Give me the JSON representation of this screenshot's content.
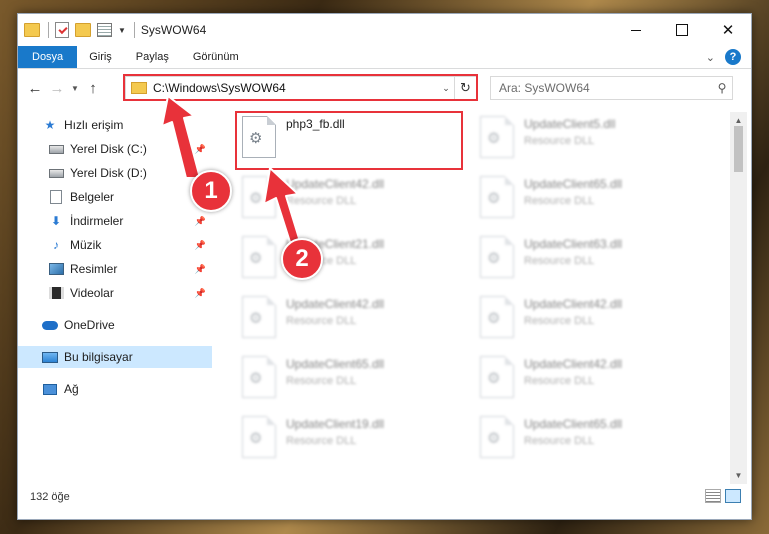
{
  "window": {
    "title": "SysWOW64",
    "controls": {
      "minimize": "",
      "maximize": "",
      "close": "✕"
    }
  },
  "ribbon": {
    "tabs": [
      "Dosya",
      "Giriş",
      "Paylaş",
      "Görünüm"
    ],
    "help": "?"
  },
  "address": {
    "path": "C:\\Windows\\SysWOW64"
  },
  "search": {
    "placeholder": "Ara: SysWOW64"
  },
  "sidebar": {
    "items": [
      {
        "label": "Hızlı erişim",
        "icon": "star-icon"
      },
      {
        "label": "Yerel Disk (C:)",
        "icon": "drive-icon",
        "pinned": true
      },
      {
        "label": "Yerel Disk (D:)",
        "icon": "drive-icon"
      },
      {
        "label": "Belgeler",
        "icon": "document-icon"
      },
      {
        "label": "İndirmeler",
        "icon": "download-icon",
        "pinned": true
      },
      {
        "label": "Müzik",
        "icon": "music-icon",
        "pinned": true
      },
      {
        "label": "Resimler",
        "icon": "pictures-icon",
        "pinned": true
      },
      {
        "label": "Videolar",
        "icon": "video-icon",
        "pinned": true
      },
      {
        "label": "OneDrive",
        "icon": "cloud-icon"
      },
      {
        "label": "Bu bilgisayar",
        "icon": "computer-icon",
        "selected": true
      },
      {
        "label": "Ağ",
        "icon": "network-icon"
      }
    ]
  },
  "files": [
    {
      "name": "php3_fb.dll",
      "type": ""
    },
    {
      "name": "UpdateClient5.dll",
      "type": "Resource DLL"
    },
    {
      "name": "UpdateClient42.dll",
      "type": "Resource DLL"
    },
    {
      "name": "UpdateClient65.dll",
      "type": "Resource DLL"
    },
    {
      "name": "UpdateClient21.dll",
      "type": "Resource DLL"
    },
    {
      "name": "UpdateClient63.dll",
      "type": "Resource DLL"
    },
    {
      "name": "UpdateClient42.dll",
      "type": "Resource DLL"
    },
    {
      "name": "UpdateClient42.dll",
      "type": "Resource DLL"
    },
    {
      "name": "UpdateClient65.dll",
      "type": "Resource DLL"
    },
    {
      "name": "UpdateClient42.dll",
      "type": "Resource DLL"
    },
    {
      "name": "UpdateClient19.dll",
      "type": "Resource DLL"
    },
    {
      "name": "UpdateClient65.dll",
      "type": "Resource DLL"
    }
  ],
  "status": {
    "item_count": "132 öğe"
  },
  "annotations": {
    "badge1": "1",
    "badge2": "2"
  },
  "colors": {
    "accent": "#1979ca",
    "annotation": "#e8323a",
    "selected_nav": "#cce8ff"
  }
}
